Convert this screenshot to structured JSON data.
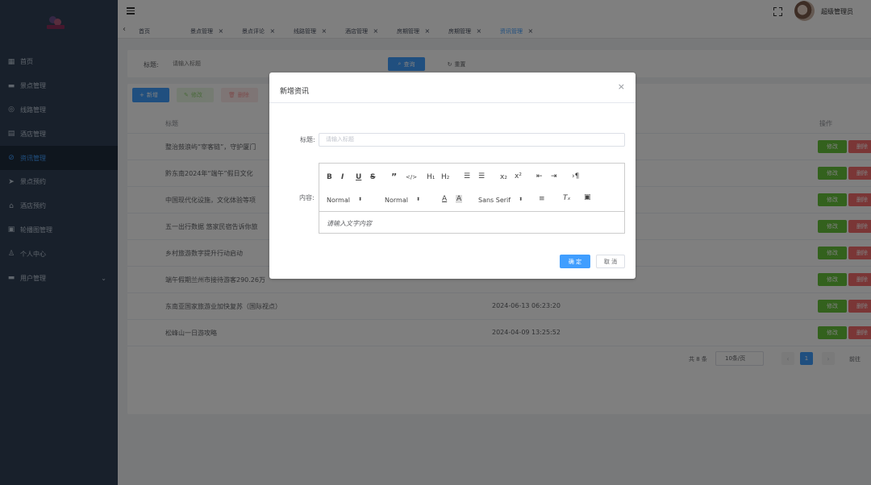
{
  "colors": {
    "sidebar": "#304156",
    "primary": "#409eff",
    "success": "#67c23a",
    "danger": "#f56c6c"
  },
  "header": {
    "username": "超级管理员"
  },
  "sidebar": {
    "items": [
      {
        "label": "首页",
        "icon": "grid-icon"
      },
      {
        "label": "景点管理",
        "icon": "ticket-icon"
      },
      {
        "label": "线路管理",
        "icon": "globe-icon"
      },
      {
        "label": "酒店管理",
        "icon": "hotel-icon"
      },
      {
        "label": "资讯管理",
        "icon": "compass-icon",
        "active": true
      },
      {
        "label": "景点预约",
        "icon": "send-icon"
      },
      {
        "label": "酒店预约",
        "icon": "home-icon"
      },
      {
        "label": "轮播图管理",
        "icon": "picture-icon"
      },
      {
        "label": "个人中心",
        "icon": "user-icon"
      },
      {
        "label": "用户管理",
        "icon": "folder-icon"
      }
    ]
  },
  "tags": [
    "首页",
    "景点管理",
    "景点评论",
    "线路管理",
    "酒店管理",
    "房期管理",
    "房期管理",
    "资讯管理"
  ],
  "search": {
    "label": "标题:",
    "placeholder": "请输入标题",
    "search_btn": "查询",
    "reset_btn": "重置"
  },
  "toolbar": {
    "add": "新增",
    "edit": "修改",
    "delete": "删除"
  },
  "table": {
    "col_title": "标题",
    "col_op": "操作",
    "edit_btn": "修改",
    "delete_btn": "删除",
    "rows": [
      {
        "title": "整治鼓浪屿“宰客链”，守护厦门",
        "time": ""
      },
      {
        "title": "黔东南2024年“端午”假日文化",
        "time": ""
      },
      {
        "title": "中国现代化设施，文化体验等项",
        "time": ""
      },
      {
        "title": "五一出行数据 悠家民宿告诉你旅",
        "time": ""
      },
      {
        "title": "乡村旅游数字提升行动启动",
        "time": ""
      },
      {
        "title": "端午假期兰州市接待游客290.26万",
        "time": ""
      },
      {
        "title": "东南亚国家旅游业加快复苏（国际视点）",
        "time": "2024-06-13 06:23:20"
      },
      {
        "title": "松峰山一日游攻略",
        "time": "2024-04-09 13:25:52"
      }
    ]
  },
  "pager": {
    "total": "共 8 条",
    "page_size": "10条/页",
    "current": "1",
    "goto": "前往"
  },
  "dialog": {
    "title": "新增资讯",
    "title_label": "标题:",
    "title_placeholder": "请输入标题",
    "content_label": "内容:",
    "editor": {
      "header1": "Normal",
      "header2": "Normal",
      "font": "Sans Serif",
      "placeholder": "请输入文字内容"
    },
    "ok": "确 定",
    "cancel": "取 消"
  }
}
